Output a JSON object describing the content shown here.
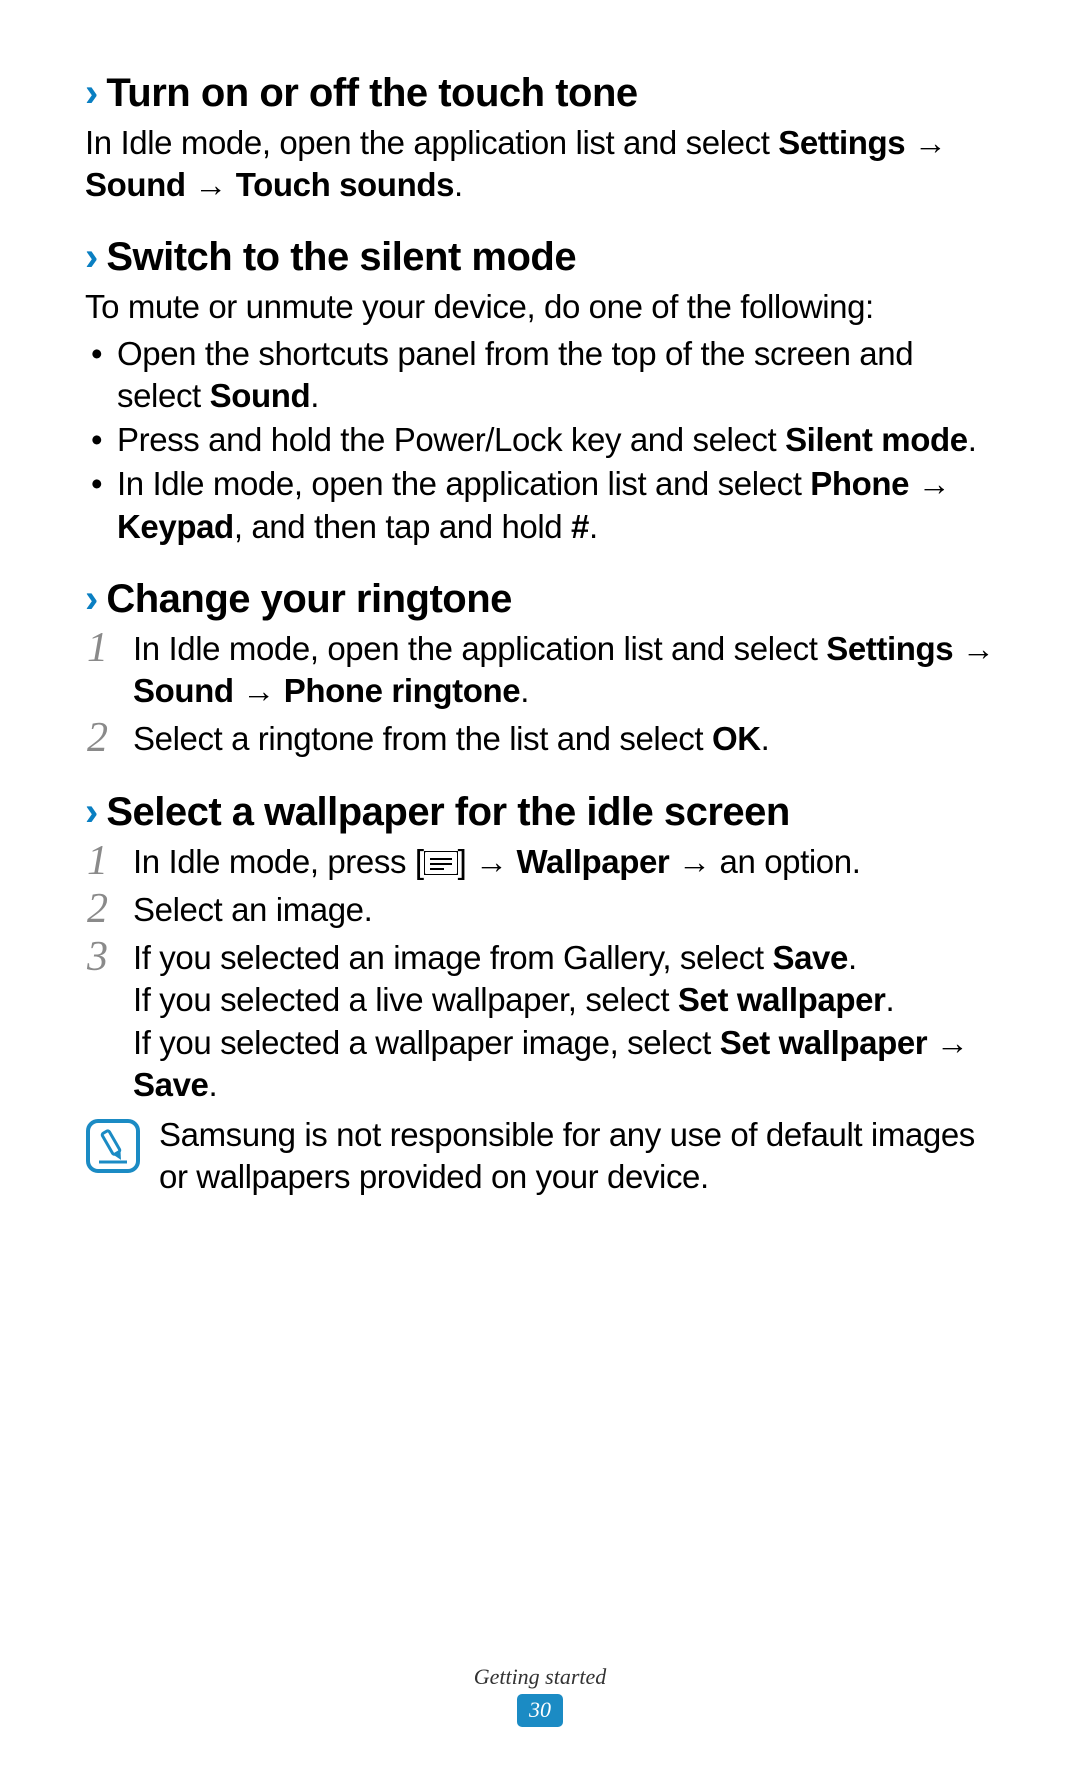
{
  "sections": {
    "touchTone": {
      "heading": "Turn on or off the touch tone",
      "p1a": "In Idle mode, open the application list and select ",
      "settings": "Settings",
      "arrow1": " →",
      "sound": "Sound",
      "arrow2": " → ",
      "touchSounds": "Touch sounds",
      "period": "."
    },
    "silent": {
      "heading": "Switch to the silent mode",
      "intro": "To mute or unmute your device, do one of the following:",
      "b1a": "Open the shortcuts panel from the top of the screen and select ",
      "b1b": "Sound",
      "b1c": ".",
      "b2a": "Press and hold the Power/Lock key and select ",
      "b2b": "Silent mode",
      "b2c": ".",
      "b3a": "In Idle mode, open the application list and select ",
      "b3b": "Phone",
      "b3arrow": " →",
      "b3c": "Keypad",
      "b3d": ", and then tap and hold ",
      "b3e": "#",
      "b3f": "."
    },
    "ringtone": {
      "heading": "Change your ringtone",
      "s1a": "In Idle mode, open the application list and select ",
      "s1b": "Settings",
      "s1arrow1": "→ ",
      "s1c": "Sound",
      "s1arrow2": " → ",
      "s1d": "Phone ringtone",
      "s1e": ".",
      "s2a": "Select a ringtone from the list and select ",
      "s2b": "OK",
      "s2c": "."
    },
    "wallpaper": {
      "heading": "Select a wallpaper for the idle screen",
      "w1a": "In Idle mode, press [",
      "w1b": "] → ",
      "w1c": "Wallpaper",
      "w1d": " → an option.",
      "w2": "Select an image.",
      "w3a": "If you selected an image from Gallery, select ",
      "w3b": "Save",
      "w3c": ".",
      "w3d": "If you selected a live wallpaper, select ",
      "w3e": "Set wallpaper",
      "w3f": ".",
      "w3g": "If you selected a wallpaper image, select ",
      "w3h": "Set wallpaper",
      "w3arrow": " →",
      "w3i": "Save",
      "w3j": "."
    },
    "note": "Samsung is not responsible for any use of default images or wallpapers provided on your device."
  },
  "footer": {
    "section": "Getting started",
    "page": "30"
  }
}
